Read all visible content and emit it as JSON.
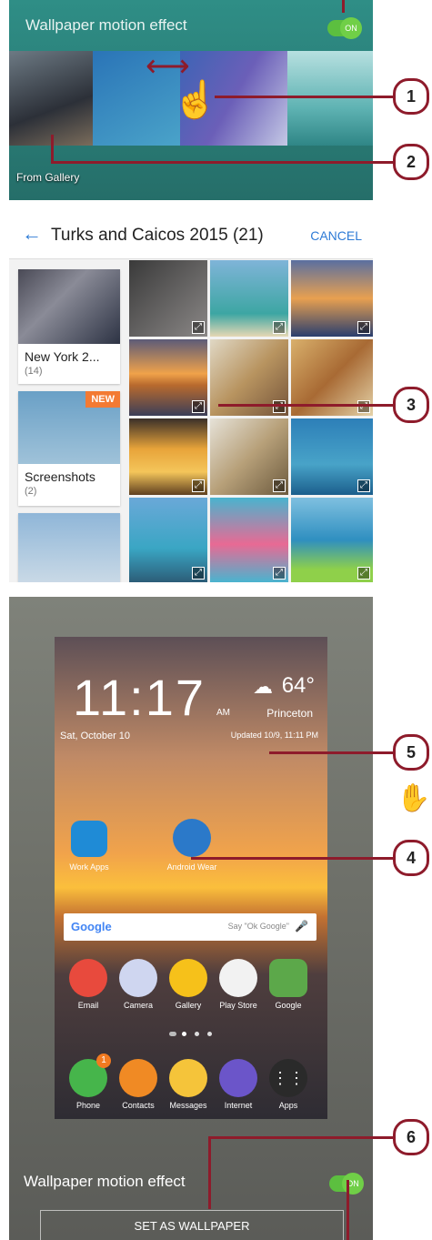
{
  "panel1": {
    "title": "Wallpaper motion effect",
    "toggle_label": "ON",
    "from_gallery": "From Gallery",
    "toggle_on": true
  },
  "panel2": {
    "title": "Turks and Caicos 2015 (21)",
    "cancel": "CANCEL",
    "albums": [
      {
        "name": "New York 2...",
        "count": "(14)"
      },
      {
        "name": "Screenshots",
        "count": "(2)",
        "badge": "NEW"
      }
    ]
  },
  "panel3": {
    "clock": "11:17",
    "ampm": "AM",
    "date": "Sat, October 10",
    "temp": "64°",
    "location": "Princeton",
    "updated": "Updated  10/9, 11:11 PM",
    "folder_label": "Work Apps",
    "widget_label": "Android Wear",
    "search_brand": "Google",
    "search_hint": "Say \"Ok Google\"",
    "apps_row1": [
      "Email",
      "Camera",
      "Gallery",
      "Play Store",
      "Google"
    ],
    "apps_row2": [
      "Phone",
      "Contacts",
      "Messages",
      "Internet",
      "Apps"
    ],
    "phone_badge": "1",
    "motion_label": "Wallpaper motion effect",
    "toggle_label": "ON",
    "set_button": "SET AS WALLPAPER"
  },
  "callouts": [
    "1",
    "2",
    "3",
    "4",
    "5",
    "6"
  ],
  "colors": {
    "accent": "#8e1b2b",
    "toggle": "#5cbf3f",
    "link": "#2e7bd6",
    "teal": "#2f8e86"
  }
}
